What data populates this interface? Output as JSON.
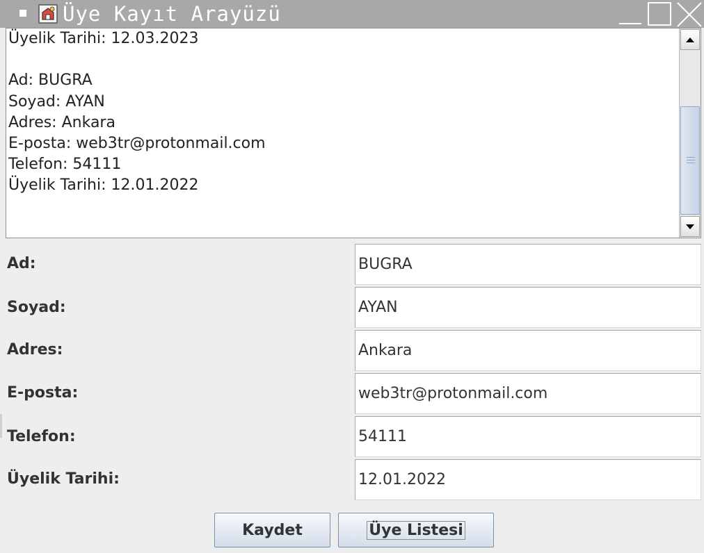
{
  "window": {
    "title": "Üye Kayıt Arayüzü"
  },
  "textarea": {
    "content": "Üyelik Tarihi: 12.03.2023\n\nAd: BUGRA\nSoyad: AYAN\nAdres: Ankara\nE-posta: web3tr@protonmail.com\nTelefon: 54111\nÜyelik Tarihi: 12.01.2022"
  },
  "form": {
    "ad_label": "Ad:",
    "ad_value": "BUGRA",
    "soyad_label": "Soyad:",
    "soyad_value": "AYAN",
    "adres_label": "Adres:",
    "adres_value": "Ankara",
    "eposta_label": "E-posta:",
    "eposta_value": "web3tr@protonmail.com",
    "telefon_label": "Telefon:",
    "telefon_value": "54111",
    "tarih_label": "Üyelik Tarihi:",
    "tarih_value": "12.01.2022"
  },
  "buttons": {
    "save_label": "Kaydet",
    "list_label": "Üye Listesi"
  },
  "colors": {
    "titlebar": "#a8a8a8",
    "window_bg": "#eeeeee",
    "scroll_thumb": "#c6d4e8"
  },
  "icons": {
    "window_menu": "window-menu-icon",
    "app": "app-icon",
    "minimize": "minimize-icon",
    "maximize": "maximize-icon",
    "close": "close-icon",
    "scroll_up": "arrow-up-icon",
    "scroll_down": "arrow-down-icon"
  }
}
